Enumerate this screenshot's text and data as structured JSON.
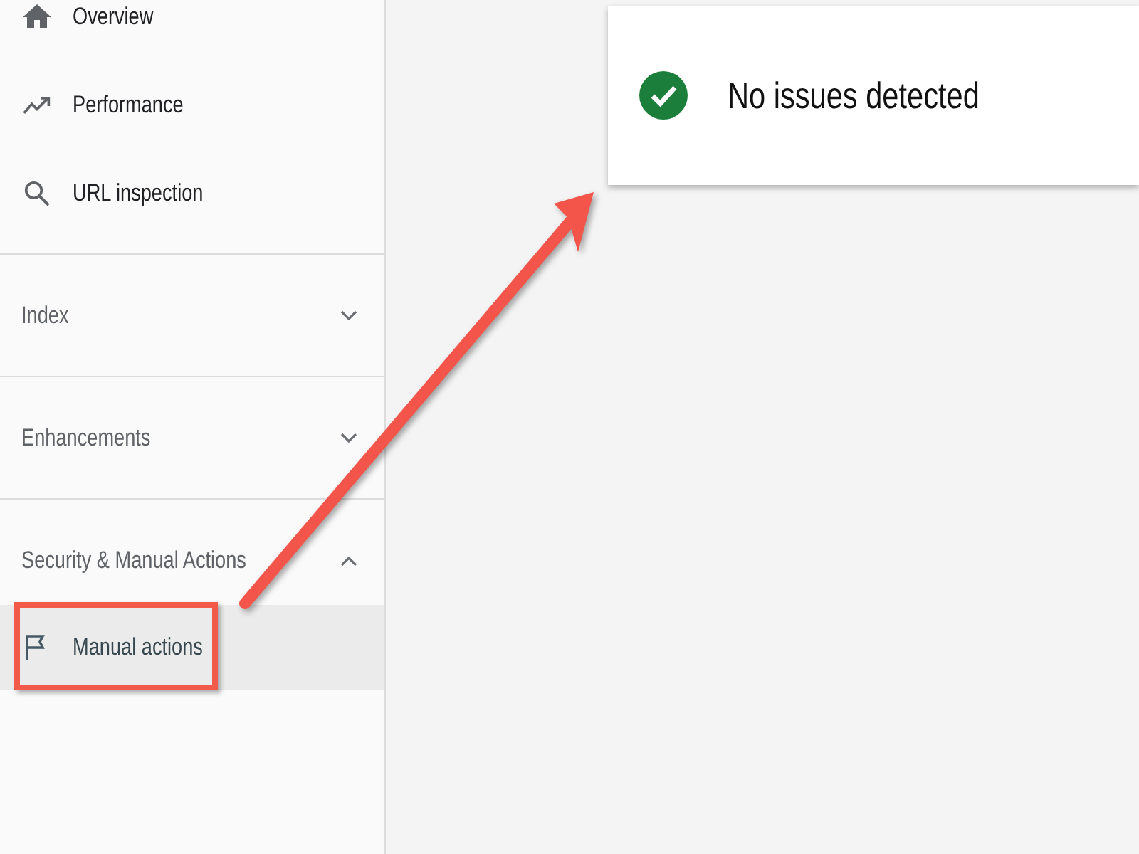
{
  "sidebar": {
    "links": [
      {
        "label": "Overview",
        "selected": false
      },
      {
        "label": "Performance",
        "selected": false
      },
      {
        "label": "URL inspection",
        "selected": false
      }
    ],
    "sections": [
      {
        "label": "Index",
        "expanded": false
      },
      {
        "label": "Enhancements",
        "expanded": false
      },
      {
        "label": "Security & Manual Actions",
        "expanded": true,
        "children": [
          {
            "label": "Manual actions",
            "selected": true,
            "highlighted": true
          }
        ]
      }
    ]
  },
  "status_card": {
    "message": "No issues detected"
  },
  "annotations": {
    "arrow": true
  }
}
